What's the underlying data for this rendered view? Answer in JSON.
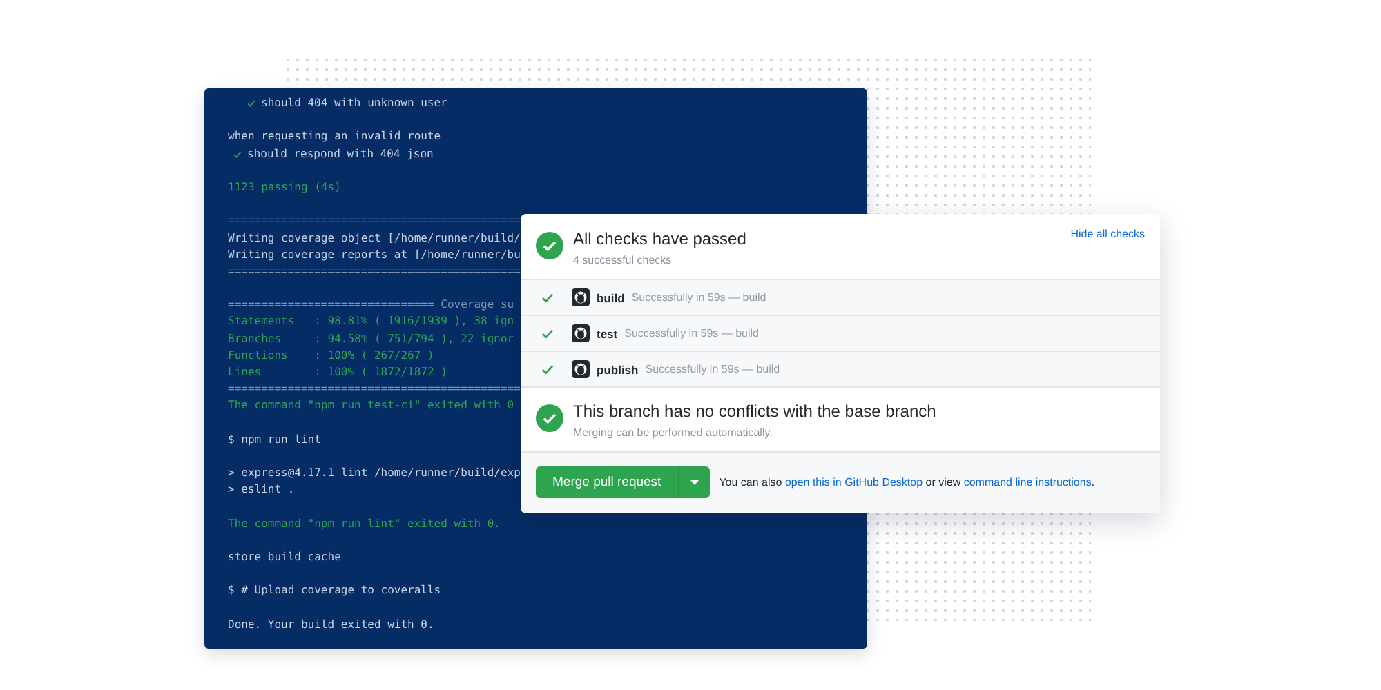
{
  "terminal": {
    "lines": [
      {
        "kind": "pass",
        "text": "should 404 with unknown user"
      },
      {
        "kind": "blank"
      },
      {
        "kind": "plain",
        "text": "when requesting an invalid route"
      },
      {
        "kind": "route_pass",
        "text": "should respond with 404 json"
      },
      {
        "kind": "blank"
      },
      {
        "kind": "success",
        "text": "1123 passing (4s)"
      },
      {
        "kind": "blank"
      },
      {
        "kind": "rule",
        "text": "============================================"
      },
      {
        "kind": "plain",
        "text": "Writing coverage object [/home/runner/build/"
      },
      {
        "kind": "plain",
        "text": "Writing coverage reports at [/home/runner/bu"
      },
      {
        "kind": "rule",
        "text": "============================================"
      },
      {
        "kind": "blank"
      },
      {
        "kind": "rule",
        "text": "=============================== Coverage su"
      },
      {
        "kind": "success",
        "text": "Statements   : 98.81% ( 1916/1939 ), 38 ign"
      },
      {
        "kind": "success",
        "text": "Branches     : 94.58% ( 751/794 ), 22 ignor"
      },
      {
        "kind": "success",
        "text": "Functions    : 100% ( 267/267 )"
      },
      {
        "kind": "success",
        "text": "Lines        : 100% ( 1872/1872 )"
      },
      {
        "kind": "rule",
        "text": "============================================"
      },
      {
        "kind": "success",
        "text": "The command \"npm run test-ci\" exited with 0"
      },
      {
        "kind": "blank"
      },
      {
        "kind": "plain",
        "text": "$ npm run lint"
      },
      {
        "kind": "blank"
      },
      {
        "kind": "plain",
        "text": "> express@4.17.1 lint /home/runner/build/exp"
      },
      {
        "kind": "plain",
        "text": "> eslint ."
      },
      {
        "kind": "blank"
      },
      {
        "kind": "success",
        "text": "The command \"npm run lint\" exited with 0."
      },
      {
        "kind": "blank"
      },
      {
        "kind": "plain",
        "text": "store build cache"
      },
      {
        "kind": "blank"
      },
      {
        "kind": "plain",
        "text": "$ # Upload coverage to coveralls"
      },
      {
        "kind": "blank"
      },
      {
        "kind": "plain",
        "text": "Done. Your build exited with 0."
      }
    ]
  },
  "checks_panel": {
    "title": "All checks have passed",
    "subtitle": "4 successful checks",
    "toggle_link": "Hide all checks",
    "checks": [
      {
        "name": "build",
        "detail": "Successfully in 59s — build",
        "passed": true
      },
      {
        "name": "test",
        "detail": "Successfully in 59s — build",
        "passed": true
      },
      {
        "name": "publish",
        "detail": "Successfully in 59s — build",
        "passed": true
      }
    ],
    "merge_status": {
      "title": "This branch has no conflicts with the base branch",
      "subtitle": "Merging can be performed automatically.",
      "ok": true
    },
    "merge_button": "Merge pull request",
    "footer": {
      "before": "You can also ",
      "link1": "open this in GitHub Desktop",
      "middle": " or view ",
      "link2": "command line instructions",
      "after": "."
    }
  }
}
